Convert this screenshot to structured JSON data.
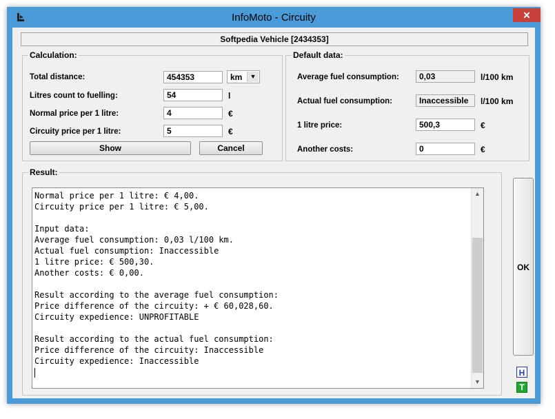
{
  "window": {
    "title": "InfoMoto - Circuity",
    "close_label": "✕"
  },
  "vehicle": "Softpedia Vehicle [2434353]",
  "calculation": {
    "title": "Calculation:",
    "total_distance_label": "Total distance:",
    "total_distance_value": "454353",
    "distance_unit": "km",
    "litres_label": "Litres count to fuelling:",
    "litres_value": "54",
    "litres_unit": "l",
    "normal_price_label": "Normal price per 1 litre:",
    "normal_price_value": "4",
    "normal_price_unit": "€",
    "circuity_price_label": "Circuity price per 1 litre:",
    "circuity_price_value": "5",
    "circuity_price_unit": "€",
    "show_label": "Show",
    "cancel_label": "Cancel"
  },
  "default_data": {
    "title": "Default data:",
    "avg_consumption_label": "Average fuel consumption:",
    "avg_consumption_value": "0,03",
    "avg_consumption_unit": "l/100 km",
    "actual_consumption_label": "Actual fuel consumption:",
    "actual_consumption_value": "Inaccessible",
    "actual_consumption_unit": "l/100 km",
    "litre_price_label": "1 litre price:",
    "litre_price_value": "500,3",
    "litre_price_unit": "€",
    "another_costs_label": "Another costs:",
    "another_costs_value": "0",
    "another_costs_unit": "€"
  },
  "result": {
    "title": "Result:",
    "lines": [
      "Normal price per 1 litre: € 4,00.",
      "Circuity price per 1 litre: € 5,00.",
      "",
      "Input data:",
      "Average fuel consumption: 0,03 l/100 km.",
      "Actual fuel consumption: Inaccessible",
      "1 litre price: € 500,30.",
      "Another costs: € 0,00.",
      "",
      "Result according to the average fuel consumption:",
      "Price difference of the circuity: + € 60,028,60.",
      "Circuity expedience: UNPROFITABLE",
      "",
      "Result according to the actual fuel consumption:",
      "Price difference of the circuity: Inaccessible",
      "Circuity expedience: Inaccessible"
    ]
  },
  "ok_label": "OK",
  "icons": {
    "h_letter": "H",
    "t_letter": "T",
    "h_color": "#1a3ea0",
    "t_color": "#21a834"
  },
  "colors": {
    "titlebar": "#4a9ad8",
    "close": "#c7413a",
    "client": "#f0f0f0"
  }
}
